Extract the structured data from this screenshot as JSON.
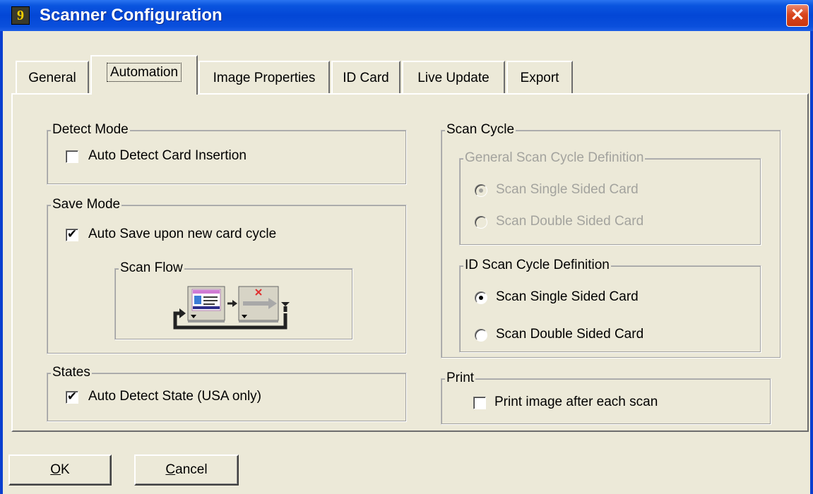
{
  "window": {
    "title": "Scanner Configuration",
    "close_label": "✕",
    "app_icon_glyph": "9"
  },
  "tabs": [
    {
      "label": "General",
      "active": false
    },
    {
      "label": "Automation",
      "active": true
    },
    {
      "label": "Image Properties",
      "active": false
    },
    {
      "label": "ID Card",
      "active": false
    },
    {
      "label": "Live Update",
      "active": false
    },
    {
      "label": "Export",
      "active": false
    }
  ],
  "detect_mode": {
    "legend": "Detect Mode",
    "auto_detect_card": {
      "label": "Auto Detect Card Insertion",
      "checked": false
    }
  },
  "save_mode": {
    "legend": "Save Mode",
    "auto_save": {
      "label": "Auto Save upon new card cycle",
      "checked": true
    },
    "scan_flow": {
      "legend": "Scan Flow",
      "icons": [
        "scan-card-icon",
        "clear-image-icon",
        "cycle-arrow-icon"
      ]
    }
  },
  "states": {
    "legend": "States",
    "auto_detect_state": {
      "label": "Auto Detect State (USA only)",
      "checked": true
    }
  },
  "scan_cycle": {
    "legend": "Scan Cycle",
    "general": {
      "legend": "General Scan Cycle Definition",
      "disabled": true,
      "options": [
        {
          "label": "Scan Single Sided Card",
          "selected": true
        },
        {
          "label": "Scan Double Sided Card",
          "selected": false
        }
      ]
    },
    "id": {
      "legend": "ID Scan Cycle Definition",
      "disabled": false,
      "options": [
        {
          "label": "Scan Single Sided Card",
          "selected": true
        },
        {
          "label": "Scan Double Sided Card",
          "selected": false
        }
      ]
    }
  },
  "print": {
    "legend": "Print",
    "print_after_scan": {
      "label": "Print image after each scan",
      "checked": false
    }
  },
  "buttons": {
    "ok_mnemonic": "O",
    "ok_rest": "K",
    "cancel_mnemonic": "C",
    "cancel_rest": "ancel"
  },
  "colors": {
    "titlebar": "#0347d6",
    "face": "#ece9d8",
    "close": "#d9451d",
    "disabled_text": "#a3a39e"
  }
}
